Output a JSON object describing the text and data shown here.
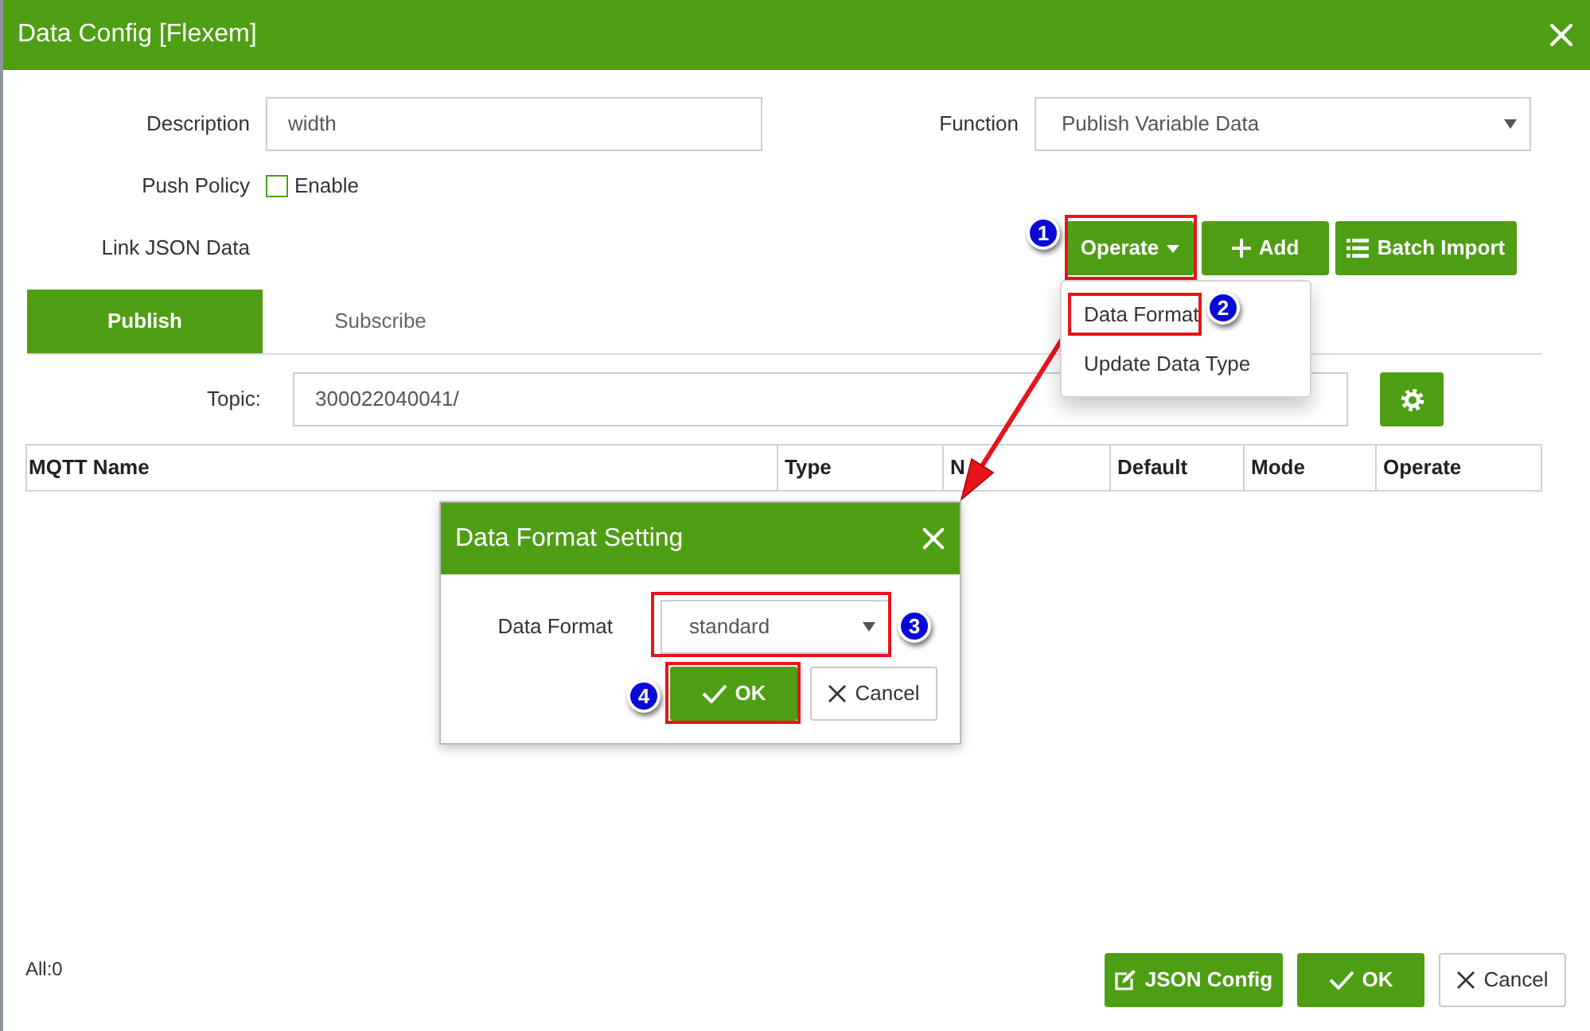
{
  "window": {
    "title": "Data Config [Flexem]"
  },
  "form": {
    "description": {
      "label": "Description",
      "value": "width"
    },
    "function": {
      "label": "Function",
      "value": "Publish Variable Data"
    },
    "push_policy": {
      "label": "Push Policy",
      "option": "Enable",
      "checked": false
    },
    "link_json_data": {
      "label": "Link JSON Data"
    }
  },
  "toolbar": [
    {
      "kind": "dropdown",
      "label": "Operate",
      "step": "1"
    },
    {
      "kind": "add",
      "label": "Add"
    },
    {
      "kind": "list",
      "label": "Batch Import"
    }
  ],
  "operate_menu": {
    "items": [
      {
        "label": "Data Format",
        "step": "2"
      },
      {
        "label": "Update Data Type"
      }
    ]
  },
  "tabs": [
    {
      "label": "Publish",
      "selected": true
    },
    {
      "label": "Subscribe",
      "selected": false
    }
  ],
  "topic": {
    "label": "Topic:",
    "value": "300022040041/"
  },
  "table": {
    "columns": [
      "MQTT Name",
      "Type",
      "N",
      "Default",
      "Mode",
      "Operate"
    ]
  },
  "dialog": {
    "title": "Data Format Setting",
    "field": {
      "label": "Data Format",
      "value": "standard",
      "step": "3"
    },
    "buttons": [
      {
        "kind": "ok",
        "label": "OK",
        "step": "4"
      },
      {
        "kind": "cancel",
        "label": "Cancel"
      }
    ]
  },
  "footer": {
    "count": "All:0",
    "buttons": [
      {
        "kind": "edit",
        "label": "JSON Config"
      },
      {
        "kind": "ok",
        "label": "OK"
      },
      {
        "kind": "cancel",
        "label": "Cancel"
      }
    ]
  }
}
